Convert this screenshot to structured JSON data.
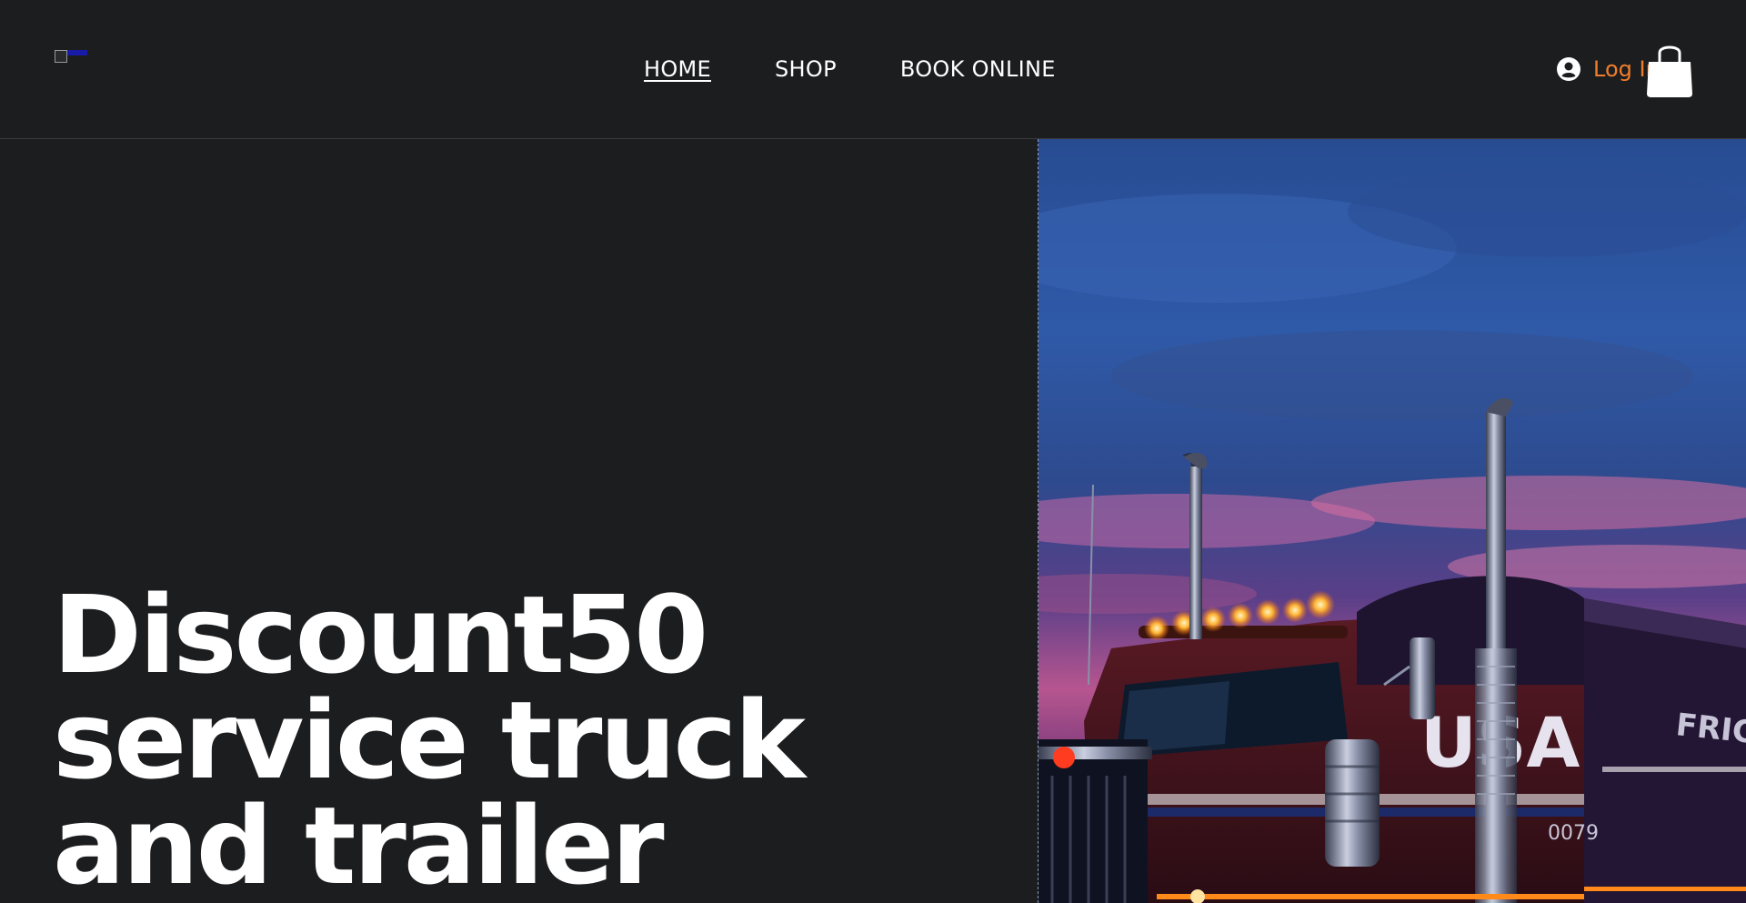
{
  "header": {
    "nav": [
      {
        "label": "HOME",
        "active": true
      },
      {
        "label": "SHOP",
        "active": false
      },
      {
        "label": "BOOK ONLINE",
        "active": false
      }
    ],
    "login_label": "Log In",
    "login_color": "#f07d2c"
  },
  "hero": {
    "headline_lines": [
      "Discount50",
      "service truck",
      "and trailer"
    ],
    "image_icon": "truck-photo",
    "image_text": {
      "side": "USA",
      "trailer": "FRIGHTLINE",
      "number": "0079"
    }
  },
  "colors": {
    "background": "#1c1d1f",
    "text": "#ffffff",
    "accent": "#f07d2c"
  }
}
